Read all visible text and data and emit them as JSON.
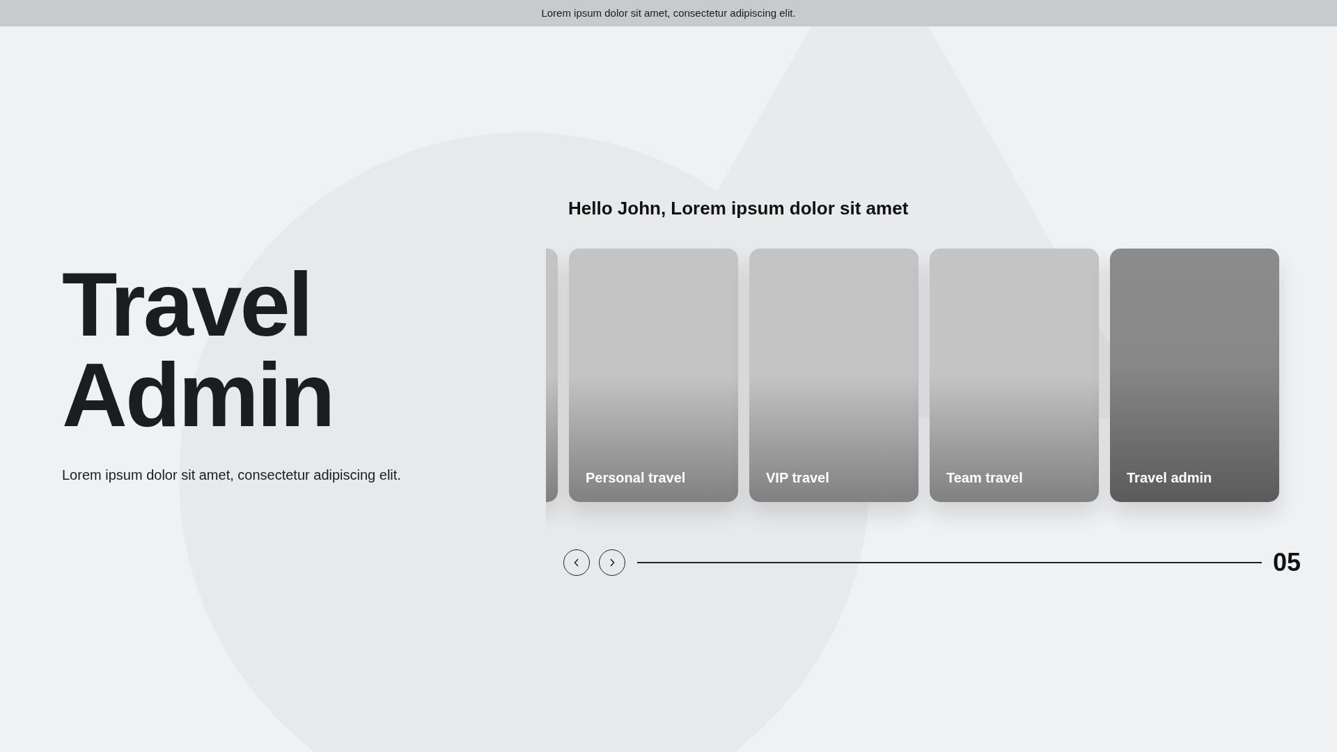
{
  "top_bar": {
    "text": "Lorem ipsum dolor sit amet, consectetur adipiscing elit."
  },
  "hero": {
    "title_lines": [
      "Travel",
      "Admin"
    ],
    "subtitle": "Lorem ipsum dolor sit amet, consectetur adipiscing elit."
  },
  "greeting": "Hello John, Lorem ipsum dolor sit amet",
  "cards": [
    {
      "kind": "partial",
      "selected": false
    },
    {
      "kind": "full",
      "label": "Personal travel",
      "selected": false
    },
    {
      "kind": "full",
      "label": "VIP travel",
      "selected": false
    },
    {
      "kind": "full",
      "label": "Team travel",
      "selected": false
    },
    {
      "kind": "full",
      "label": "Travel admin",
      "selected": true
    }
  ],
  "pager": {
    "counter": "05"
  }
}
